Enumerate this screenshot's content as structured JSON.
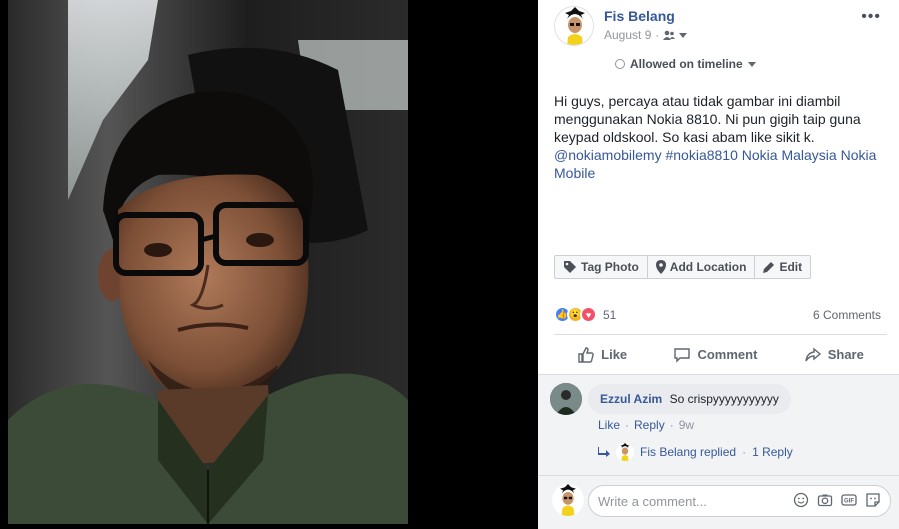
{
  "post": {
    "author": "Fis Belang",
    "date": "August 9",
    "separator": "·",
    "more_label": "•••",
    "timeline_status": "Allowed on timeline",
    "caption_text": "Hi guys, percaya atau tidak gambar ini diambil menggunakan Nokia 8810. Ni pun gigih taip guna keypad oldskool. So kasi abam like sikit k.",
    "mention": "@nokiamobilemy",
    "hashtag": "#nokia8810",
    "link_tag": "Nokia Malaysia",
    "link_tag2": "Nokia Mobile"
  },
  "photo_tools": {
    "tag_photo": "Tag Photo",
    "add_location": "Add Location",
    "edit": "Edit"
  },
  "reactions": {
    "count": "51",
    "comments_count": "6 Comments",
    "types": [
      "like",
      "wow",
      "love"
    ]
  },
  "actions": {
    "like": "Like",
    "comment": "Comment",
    "share": "Share"
  },
  "comment": {
    "author": "Ezzul Azim",
    "text": "So crispyyyyyyyyyyy",
    "like": "Like",
    "reply": "Reply",
    "time": "9w",
    "replied_by": "Fis Belang replied",
    "reply_count": "1 Reply"
  },
  "composer": {
    "placeholder": "Write a comment..."
  },
  "colors": {
    "link": "#365899",
    "like_blue": "#4080ff",
    "love_red": "#f25268",
    "wow_yellow": "#f7b125"
  }
}
